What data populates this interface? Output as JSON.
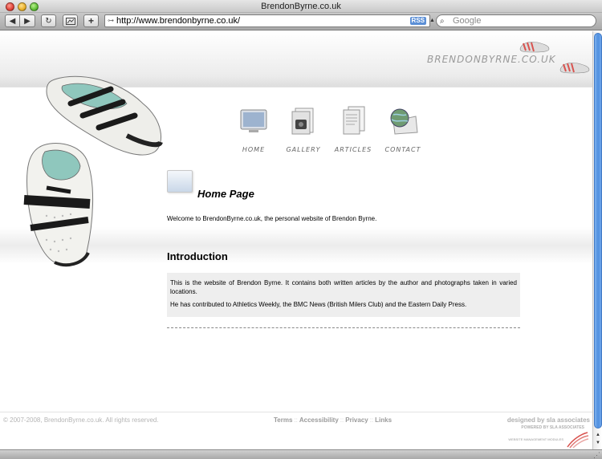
{
  "window": {
    "title": "BrendonByrne.co.uk"
  },
  "toolbar": {
    "back_icon": "◀",
    "forward_icon": "▶",
    "reload_icon": "↻",
    "add_icon": "+",
    "url": "http://www.brendonbyrne.co.uk/",
    "rss_label": "RSS",
    "search_placeholder": "Google"
  },
  "site": {
    "logo": "BRENDONBYRNE.CO.UK",
    "nav": [
      {
        "label": "Home",
        "icon": "monitor-icon"
      },
      {
        "label": "Gallery",
        "icon": "photo-gallery-icon"
      },
      {
        "label": "Articles",
        "icon": "documents-icon"
      },
      {
        "label": "Contact",
        "icon": "globe-envelope-icon"
      }
    ],
    "page_title": "Home Page",
    "welcome": "Welcome to BrendonByrne.co.uk, the personal website of Brendon Byrne.",
    "intro_heading": "Introduction",
    "intro_paragraphs": [
      "This is the website of Brendon Byrne. It contains both written articles by the author and photographs taken in varied locations.",
      "He has contributed to Athletics Weekly, the BMC News (British Milers Club) and the Eastern Daily Press."
    ]
  },
  "footer": {
    "copyright": "© 2007-2008, BrendonByrne.co.uk. All rights reserved.",
    "links": [
      "Terms",
      "Accessibility",
      "Privacy",
      "Links"
    ],
    "separator": "::",
    "designed_by": "designed by sla associates",
    "powered_by": "POWERED BY SLA ASSOCIATES",
    "badge_text": "WEBSITE MANAGEMENT MODULES"
  },
  "colors": {
    "accent": "#4f8fe0",
    "logo_red": "#d9534f",
    "text_muted": "#9a9a9a"
  }
}
